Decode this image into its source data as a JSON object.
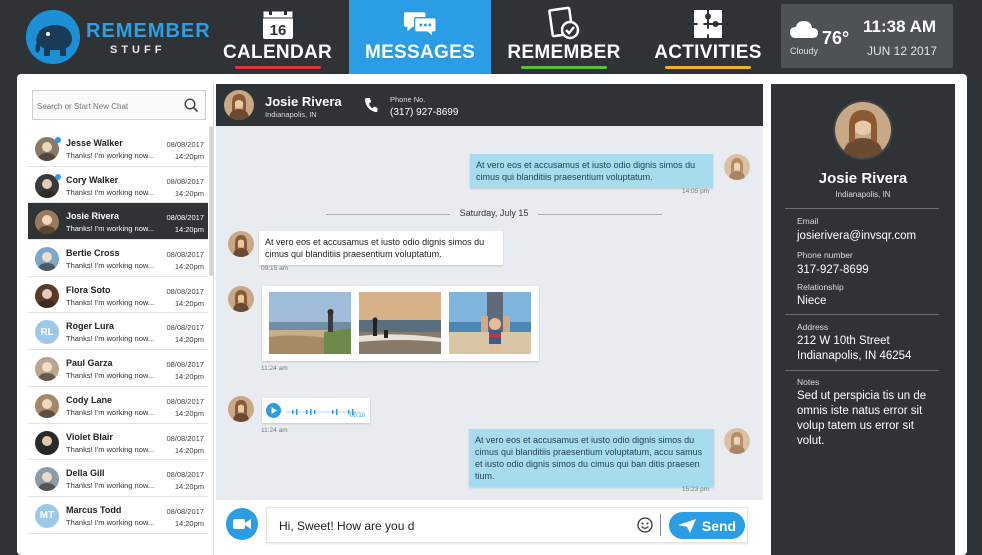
{
  "app": {
    "logo_line1": "REMEMBER",
    "logo_line2": "STUFF"
  },
  "nav": {
    "calendar_label": "CALENDAR",
    "calendar_day": "16",
    "messages_label": "MESSAGES",
    "remember_label": "REMEMBER",
    "activities_label": "ACTIVITIES",
    "active_tab": "MESSAGES",
    "underline_colors": {
      "calendar": "#e0353c",
      "remember": "#5bbf3a",
      "activities": "#f0b31d"
    }
  },
  "weather": {
    "condition": "Cloudy",
    "temperature": "76°",
    "time": "11:38 AM",
    "date": "JUN 12 2017"
  },
  "search": {
    "placeholder": "Search or Start New Chat"
  },
  "contacts": [
    {
      "name": "Jesse Walker",
      "preview": "Thanks! I'm working now...",
      "date": "08/08/2017",
      "time": "14:20pm",
      "unread": true,
      "initials": "",
      "avatar_color": "#8a7a6a"
    },
    {
      "name": "Cory Walker",
      "preview": "Thanks! I'm working now...",
      "date": "08/08/2017",
      "time": "14:20pm",
      "unread": true,
      "initials": "",
      "avatar_color": "#3a3a3a"
    },
    {
      "name": "Josie Rivera",
      "preview": "Thanks! I'm working now...",
      "date": "08/08/2017",
      "time": "14:20pm",
      "unread": false,
      "initials": "",
      "avatar_color": "#9a7a5c",
      "active": true
    },
    {
      "name": "Bertie Cross",
      "preview": "Thanks! I'm working now...",
      "date": "08/08/2017",
      "time": "14:20pm",
      "unread": false,
      "initials": "",
      "avatar_color": "#7fa5c7"
    },
    {
      "name": "Flora Soto",
      "preview": "Thanks! I'm working now...",
      "date": "08/08/2017",
      "time": "14:20pm",
      "unread": false,
      "initials": "",
      "avatar_color": "#5a3a2a"
    },
    {
      "name": "Roger Lura",
      "preview": "Thanks! I'm working now...",
      "date": "08/08/2017",
      "time": "14:20pm",
      "unread": false,
      "initials": "RL",
      "avatar_color": "#9cc9ea"
    },
    {
      "name": "Paul Garza",
      "preview": "Thanks! I'm working now...",
      "date": "08/08/2017",
      "time": "14:20pm",
      "unread": false,
      "initials": "",
      "avatar_color": "#b8a592"
    },
    {
      "name": "Cody Lane",
      "preview": "Thanks! I'm working now...",
      "date": "08/08/2017",
      "time": "14:20pm",
      "unread": false,
      "initials": "",
      "avatar_color": "#a58a6a"
    },
    {
      "name": "Violet Blair",
      "preview": "Thanks! I'm working now...",
      "date": "08/08/2017",
      "time": "14:20pm",
      "unread": false,
      "initials": "",
      "avatar_color": "#2a2a2a"
    },
    {
      "name": "Della Gill",
      "preview": "Thanks! I'm working now...",
      "date": "08/08/2017",
      "time": "14:20pm",
      "unread": false,
      "initials": "",
      "avatar_color": "#8e9aa8"
    },
    {
      "name": "Marcus Todd",
      "preview": "Thanks! I'm working now...",
      "date": "08/08/2017",
      "time": "14:20pm",
      "unread": false,
      "initials": "MT",
      "avatar_color": "#9cc9ea"
    }
  ],
  "chat_header": {
    "name": "Josie Rivera",
    "location": "Indianapolis, IN",
    "phone_label": "Phone No.",
    "phone": "(317) 927-8699"
  },
  "messages": {
    "m1_text": "At vero eos et accusamus et iusto odio dignis simos du cimus qui blanditiis praesentium voluptatum.",
    "m1_time": "14:05 pm",
    "day_separator": "Saturday, July 15",
    "m2_text": "At vero eos et accusamus et iusto odio dignis simos du cimus qui blanditiis praesentium voluptatum.",
    "m2_time": "09:15 am",
    "m3_time": "11:24 am",
    "m4_duration": "00:10",
    "m4_time": "11:24 am",
    "m5_text": "At vero eos et accusamus et iusto odio dignis simos du cimus qui blanditiis praesentium voluptatum, accu samus et iusto odio dignis simos du cimus qui ban ditis praesen tium.",
    "m5_time": "15:23 pm"
  },
  "composer": {
    "text": "Hi, Sweet! How are you d",
    "send_label": "Send"
  },
  "profile": {
    "name": "Josie Rivera",
    "location": "Indianapolis, IN",
    "email_label": "Email",
    "email": "josierivera@invsqr.com",
    "phone_label": "Phone number",
    "phone": "317-927-8699",
    "relationship_label": "Relationship",
    "relationship": "Niece",
    "address_label": "Address",
    "address_line1": "212 W 10th Street",
    "address_line2": "Indianapolis, IN 46254",
    "notes_label": "Notes",
    "notes": "Sed ut perspicia tis un de omnis iste natus error sit volup tatem us error sit volut."
  },
  "colors": {
    "accent": "#2a9de4",
    "dark": "#2f3336",
    "outgoing_bubble": "#a7dcef",
    "chat_bg": "#e8ecf1"
  }
}
